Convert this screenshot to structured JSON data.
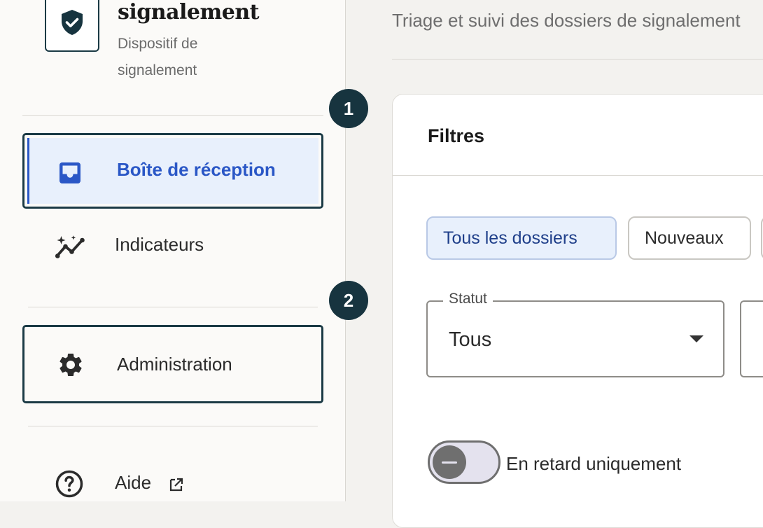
{
  "app": {
    "title": "signalement",
    "subtitle": "Dispositif de signalement",
    "logo_icon": "shield-check-icon"
  },
  "sidebar": {
    "items": [
      {
        "label": "Boîte de réception",
        "icon": "inbox-icon",
        "active": true
      },
      {
        "label": "Indicateurs",
        "icon": "insights-icon"
      },
      {
        "label": "Administration",
        "icon": "gear-icon"
      },
      {
        "label": "Aide",
        "icon": "help-circle-icon",
        "trailing_icon": "external-link-icon"
      }
    ]
  },
  "badges": [
    "1",
    "2"
  ],
  "header": {
    "description": "Triage et suivi des dossiers de signalement"
  },
  "filters": {
    "title": "Filtres",
    "chips": [
      {
        "label": "Tous les dossiers",
        "selected": true
      },
      {
        "label": "Nouveaux",
        "selected": false
      }
    ],
    "status_select": {
      "label": "Statut",
      "value": "Tous"
    },
    "overdue_toggle": {
      "label": "En retard uniquement",
      "checked": false
    }
  },
  "colors": {
    "brand_dark": "#17343f",
    "accent_blue": "#2a57c6",
    "active_bg": "#e8f0fc"
  }
}
